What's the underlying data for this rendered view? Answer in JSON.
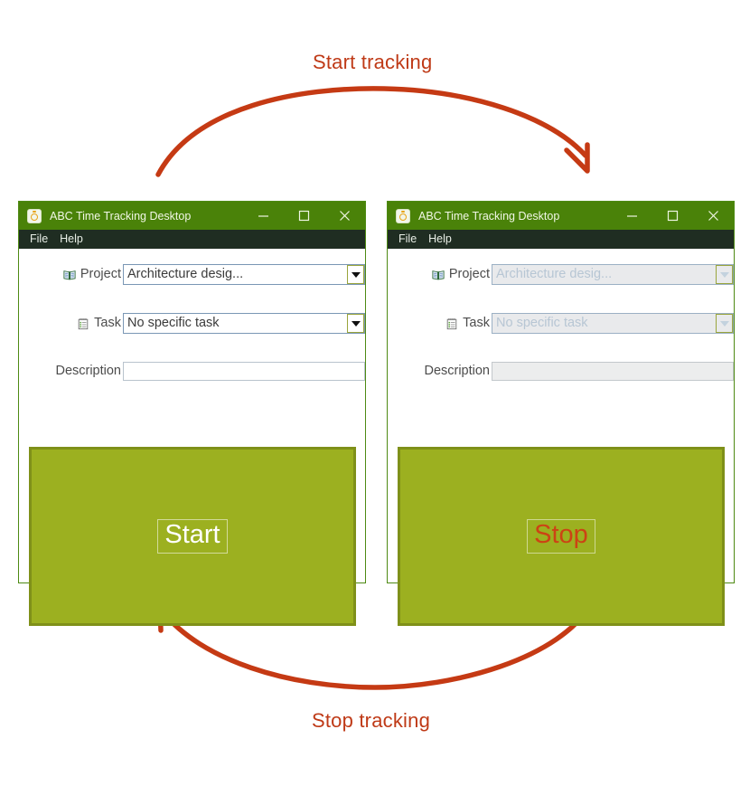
{
  "annotations": {
    "accent_color": "#bf3a17",
    "top": {
      "caption": "Start tracking",
      "arrow": "curved-arrow-right-down-icon"
    },
    "bottom": {
      "caption": "Stop tracking",
      "arrow": "curved-arrow-left-up-icon"
    }
  },
  "windows": [
    {
      "id": "start",
      "title": "ABC Time Tracking Desktop",
      "app_icon": "timer-app-icon",
      "titlebar_color": "#4a8209",
      "menubar_color": "#1f2d22",
      "menu": [
        {
          "label": "File"
        },
        {
          "label": "Help"
        }
      ],
      "controls": [
        {
          "name": "minimize",
          "glyph": "minimize-icon"
        },
        {
          "name": "maximize",
          "glyph": "maximize-icon"
        },
        {
          "name": "close",
          "glyph": "close-icon"
        }
      ],
      "form": {
        "project": {
          "label": "Project",
          "icon": "book-icon",
          "value": "Architecture desig...",
          "disabled": false
        },
        "task": {
          "label": "Task",
          "icon": "notepad-icon",
          "value": "No specific task",
          "disabled": false
        },
        "description": {
          "label": "Description",
          "value": "",
          "placeholder": "",
          "disabled": false
        }
      },
      "action": {
        "label": "Start",
        "text_color": "#ffffff",
        "fill_color": "#9cb020",
        "border_color": "#7f9019",
        "focused": true
      }
    },
    {
      "id": "stop",
      "title": "ABC Time Tracking Desktop",
      "app_icon": "timer-app-icon",
      "titlebar_color": "#4a8209",
      "menubar_color": "#1f2d22",
      "menu": [
        {
          "label": "File"
        },
        {
          "label": "Help"
        }
      ],
      "controls": [
        {
          "name": "minimize",
          "glyph": "minimize-icon"
        },
        {
          "name": "maximize",
          "glyph": "maximize-icon"
        },
        {
          "name": "close",
          "glyph": "close-icon"
        }
      ],
      "form": {
        "project": {
          "label": "Project",
          "icon": "book-icon",
          "value": "Architecture desig...",
          "disabled": true
        },
        "task": {
          "label": "Task",
          "icon": "notepad-icon",
          "value": "No specific task",
          "disabled": true
        },
        "description": {
          "label": "Description",
          "value": "",
          "placeholder": "",
          "disabled": true
        }
      },
      "action": {
        "label": "Stop",
        "text_color": "#cc4314",
        "fill_color": "#9cb020",
        "border_color": "#7f9019",
        "focused": true
      }
    }
  ]
}
